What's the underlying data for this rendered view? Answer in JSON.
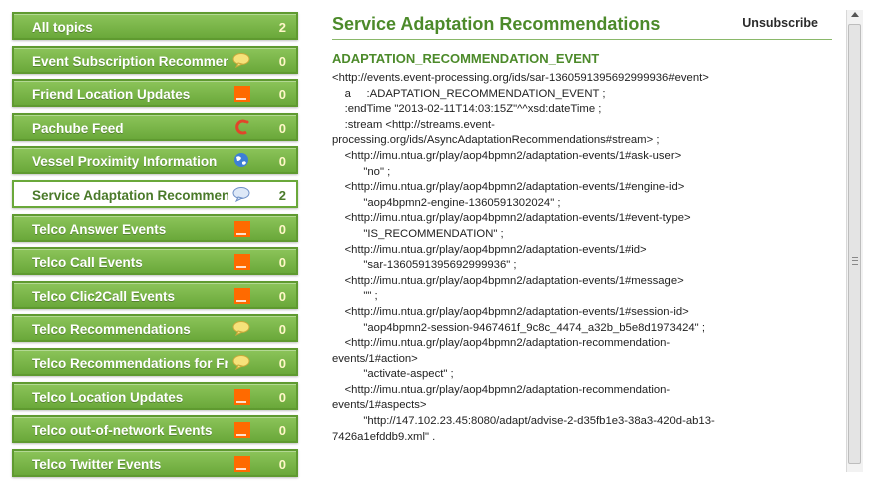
{
  "sidebar": {
    "topics": [
      {
        "label": "All topics",
        "count": "2",
        "icon": "none"
      },
      {
        "label": "Event Subscription Recommendations",
        "count": "0",
        "icon": "speech-bubble-yellow-icon"
      },
      {
        "label": "Friend Location Updates",
        "count": "0",
        "icon": "orange-logo-icon"
      },
      {
        "label": "Pachube Feed",
        "count": "0",
        "icon": "pachube-logo-icon"
      },
      {
        "label": "Vessel Proximity Information",
        "count": "0",
        "icon": "globe-icon"
      },
      {
        "label": "Service Adaptation Recommendations",
        "count": "2",
        "icon": "speech-bubble-blue-icon",
        "selected": true
      },
      {
        "label": "Telco Answer Events",
        "count": "0",
        "icon": "orange-logo-icon"
      },
      {
        "label": "Telco Call Events",
        "count": "0",
        "icon": "orange-logo-icon"
      },
      {
        "label": "Telco Clic2Call Events",
        "count": "0",
        "icon": "orange-logo-icon"
      },
      {
        "label": "Telco Recommendations",
        "count": "0",
        "icon": "speech-bubble-yellow-icon"
      },
      {
        "label": "Telco Recommendations for Friends",
        "count": "0",
        "icon": "speech-bubble-yellow-icon"
      },
      {
        "label": "Telco Location Updates",
        "count": "0",
        "icon": "orange-logo-icon"
      },
      {
        "label": "Telco out-of-network Events",
        "count": "0",
        "icon": "orange-logo-icon"
      },
      {
        "label": "Telco Twitter Events",
        "count": "0",
        "icon": "orange-logo-icon"
      }
    ]
  },
  "main": {
    "title": "Service Adaptation Recommendations",
    "unsubscribe_label": "Unsubscribe",
    "event_type": "ADAPTATION_RECOMMENDATION_EVENT",
    "lines": [
      "<http://events.event-processing.org/ids/sar-1360591395692999936#event>",
      "    a     :ADAPTATION_RECOMMENDATION_EVENT ;",
      "    :endTime \"2013-02-11T14:03:15Z\"^^xsd:dateTime ;",
      "    :stream <http://streams.event-",
      "processing.org/ids/AsyncAdaptationRecommendations#stream> ;",
      "    <http://imu.ntua.gr/play/aop4bpmn2/adaptation-events/1#ask-user>",
      "          \"no\" ;",
      "    <http://imu.ntua.gr/play/aop4bpmn2/adaptation-events/1#engine-id>",
      "          \"aop4bpmn2-engine-1360591302024\" ;",
      "    <http://imu.ntua.gr/play/aop4bpmn2/adaptation-events/1#event-type>",
      "          \"IS_RECOMMENDATION\" ;",
      "    <http://imu.ntua.gr/play/aop4bpmn2/adaptation-events/1#id>",
      "          \"sar-1360591395692999936\" ;",
      "    <http://imu.ntua.gr/play/aop4bpmn2/adaptation-events/1#message>",
      "          \"\" ;",
      "    <http://imu.ntua.gr/play/aop4bpmn2/adaptation-events/1#session-id>",
      "          \"aop4bpmn2-session-9467461f_9c8c_4474_a32b_b5e8d1973424\" ;",
      "    <http://imu.ntua.gr/play/aop4bpmn2/adaptation-recommendation-",
      "events/1#action>",
      "          \"activate-aspect\" ;",
      "    <http://imu.ntua.gr/play/aop4bpmn2/adaptation-recommendation-",
      "events/1#aspects>",
      "          \"http://147.102.23.45:8080/adapt/advise-2-d35fb1e3-38a3-420d-ab13-",
      "7426a1efddb9.xml\" ."
    ]
  },
  "colors": {
    "accent_green": "#6aa83a",
    "title_green": "#4c8a2a",
    "orange_brand": "#ff6a00"
  }
}
